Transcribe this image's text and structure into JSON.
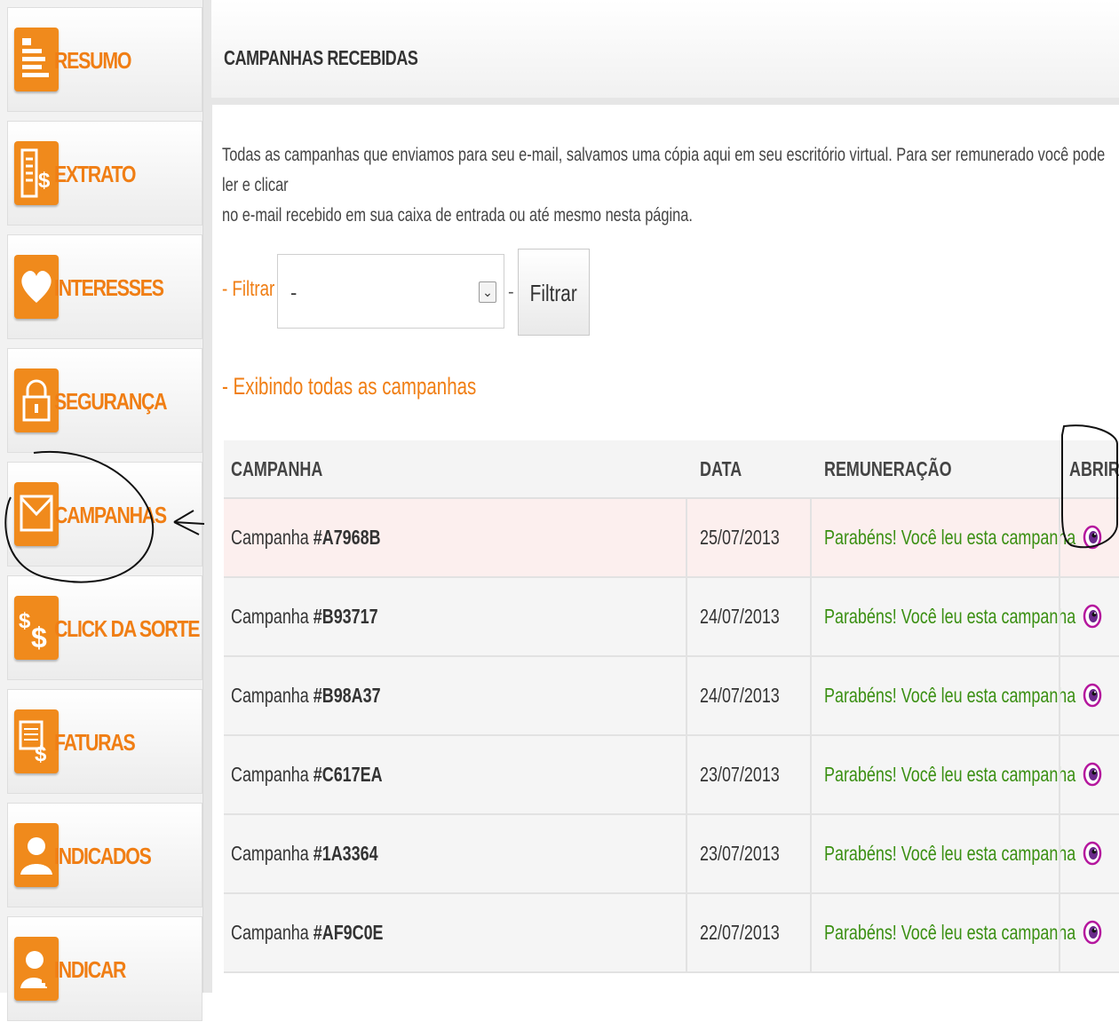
{
  "sidebar": {
    "items": [
      {
        "label": "RESUMO",
        "icon": "document-list-icon"
      },
      {
        "label": "EXTRATO",
        "icon": "statement-dollar-icon"
      },
      {
        "label": "INTERESSES",
        "icon": "heart-icon"
      },
      {
        "label": "SEGURANÇA",
        "icon": "lock-icon"
      },
      {
        "label": "CAMPANHAS",
        "icon": "envelope-icon"
      },
      {
        "label": "CLICK DA SORTE",
        "icon": "dollar-signs-icon"
      },
      {
        "label": "FATURAS",
        "icon": "invoice-icon"
      },
      {
        "label": "INDICADOS",
        "icon": "user-icon"
      },
      {
        "label": "INDICAR",
        "icon": "add-user-icon"
      }
    ]
  },
  "header": {
    "title": "CAMPANHAS RECEBIDAS"
  },
  "intro": {
    "line1": "Todas as campanhas que enviamos para seu e-mail, salvamos uma cópia aqui em seu escritório virtual. Para ser remunerado você pode ler e clicar",
    "line2": "no e-mail recebido em sua caixa de entrada ou até mesmo nesta página."
  },
  "filter": {
    "label": "- Filtrar",
    "selected_value": "-",
    "separator": "-",
    "button_label": "Filtrar"
  },
  "showing_label": "- Exibindo todas as campanhas",
  "table": {
    "headers": {
      "campaign": "CAMPANHA",
      "date": "DATA",
      "reward": "REMUNERAÇÃO",
      "open": "ABRIR"
    },
    "rows": [
      {
        "prefix": "Campanha",
        "code": "#A7968B",
        "date": "25/07/2013",
        "status": "Parabéns! Você leu esta campanha"
      },
      {
        "prefix": "Campanha",
        "code": "#B93717",
        "date": "24/07/2013",
        "status": "Parabéns! Você leu esta campanha"
      },
      {
        "prefix": "Campanha",
        "code": "#B98A37",
        "date": "24/07/2013",
        "status": "Parabéns! Você leu esta campanha"
      },
      {
        "prefix": "Campanha",
        "code": "#C617EA",
        "date": "23/07/2013",
        "status": "Parabéns! Você leu esta campanha"
      },
      {
        "prefix": "Campanha",
        "code": "#1A3364",
        "date": "23/07/2013",
        "status": "Parabéns! Você leu esta campanha"
      },
      {
        "prefix": "Campanha",
        "code": "#AF9C0E",
        "date": "22/07/2013",
        "status": "Parabéns! Você leu esta campanha"
      }
    ]
  },
  "colors": {
    "accent": "#f07e14",
    "icon_bg": "#f08a1c",
    "success": "#3a8f12",
    "highlight_row": "#fcefee"
  }
}
